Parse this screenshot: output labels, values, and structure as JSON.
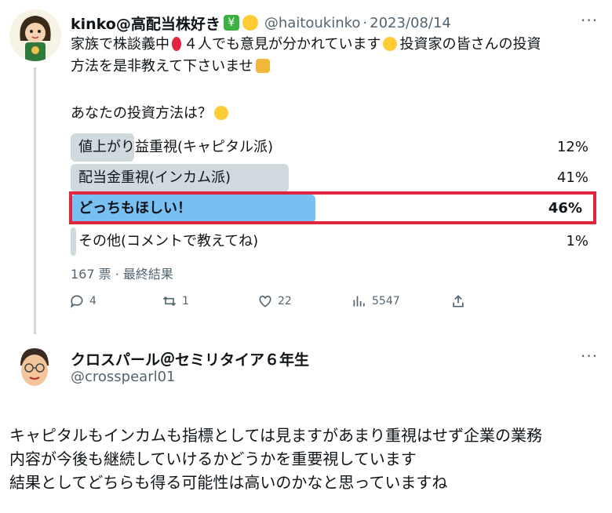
{
  "tweet": {
    "display_name": "kinko@高配当株好き",
    "handle": "@haitoukinko",
    "separator": "·",
    "date": "2023/08/14",
    "text_line1": "家族で株談義中",
    "text_line1b": "４人でも意見が分かれています",
    "text_line1c": "投資家の皆さんの投資",
    "text_line2": "方法を是非教えて下さいませ",
    "question": "あなたの投資方法は？",
    "poll": [
      {
        "label": "値上がり益重視(キャピタル派)",
        "percent": 12,
        "percent_text": "12%"
      },
      {
        "label": "配当金重視(インカム派)",
        "percent": 41,
        "percent_text": "41%"
      },
      {
        "label": "どっちもほしい！",
        "percent": 46,
        "percent_text": "46%"
      },
      {
        "label": "その他(コメントで教えてね)",
        "percent": 1,
        "percent_text": "1%"
      }
    ],
    "votes_text": "167 票 · 最終結果",
    "actions": {
      "replies": "4",
      "retweets": "1",
      "likes": "22",
      "views": "5547"
    },
    "colors": {
      "poll_bar": "#cfd9de",
      "poll_winner": "#79c0f2",
      "highlight": "#e0253f"
    }
  },
  "reply": {
    "display_name": "クロスパール＠セミリタイア６年生",
    "handle": "@crosspearl01",
    "text_line1": "キャピタルもインカムも指標としては見ますがあまり重視はせず企業の業務",
    "text_line2": "内容が今後も継続していけるかどうかを重要視しています",
    "text_line3": "結果としてどちらも得る可能性は高いのかなと思っていますね"
  }
}
